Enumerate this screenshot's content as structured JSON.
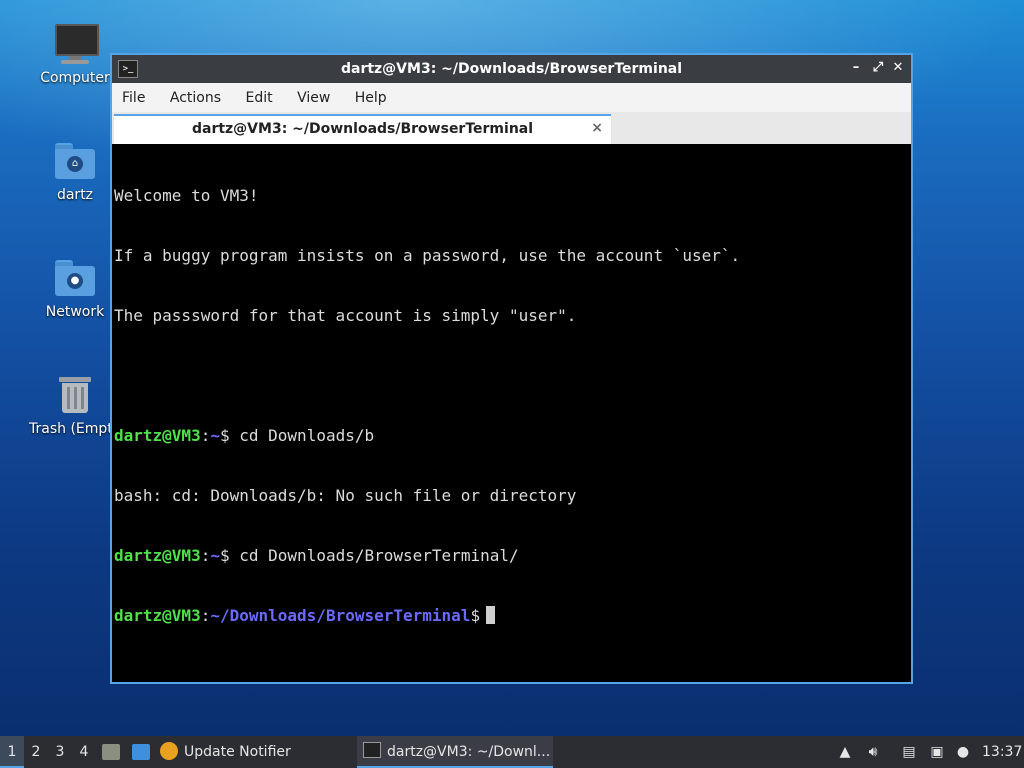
{
  "desktop": {
    "icons": [
      {
        "label": "Computer",
        "icon": "computer-icon"
      },
      {
        "label": "dartz",
        "icon": "home-folder-icon"
      },
      {
        "label": "Network",
        "icon": "network-folder-icon"
      },
      {
        "label": "Trash (Empty)",
        "icon": "trash-icon"
      }
    ]
  },
  "window": {
    "title": "dartz@VM3: ~/Downloads/BrowserTerminal",
    "app_icon_glyph": ">_",
    "controls": {
      "minimize": "–",
      "maximize": "⤢",
      "close": "✕"
    },
    "menu": [
      "File",
      "Actions",
      "Edit",
      "View",
      "Help"
    ],
    "tab": {
      "label": "dartz@VM3: ~/Downloads/BrowserTerminal",
      "close": "×"
    }
  },
  "terminal": {
    "welcome": [
      "Welcome to VM3!",
      "If a buggy program insists on a password, use the account `user`.",
      "The passsword for that account is simply \"user\"."
    ],
    "prompt_user": "dartz@VM3",
    "cmd1": {
      "path": "~",
      "command": " cd Downloads/b"
    },
    "error": "bash: cd: Downloads/b: No such file or directory",
    "cmd2": {
      "path": "~",
      "command": " cd Downloads/BrowserTerminal/"
    },
    "cmd3": {
      "path": "~/Downloads/BrowserTerminal",
      "command": " "
    }
  },
  "taskbar": {
    "workspaces": [
      "1",
      "2",
      "3",
      "4"
    ],
    "active_workspace": "1",
    "tasks": [
      {
        "label": "Update Notifier"
      },
      {
        "label": "dartz@VM3: ~/Downl..."
      }
    ],
    "clock": "13:37",
    "colors": {
      "accent": "#56a4e6",
      "prompt_user": "#4fe04a",
      "prompt_path": "#6a6aff"
    }
  }
}
